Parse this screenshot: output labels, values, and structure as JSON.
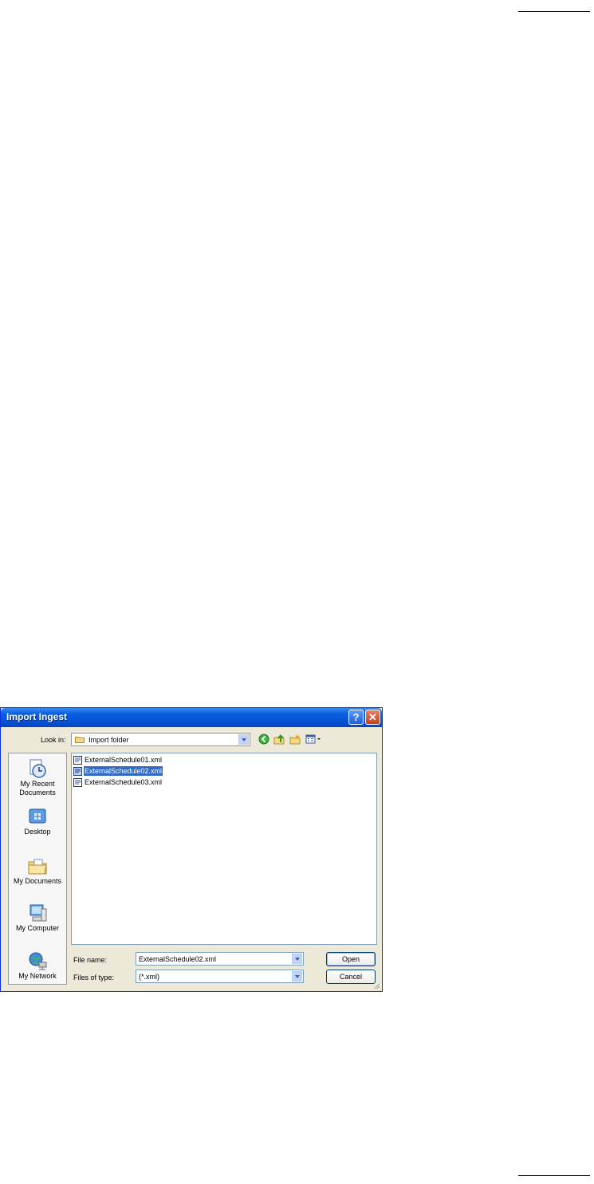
{
  "dialog": {
    "title": "Import Ingest",
    "help_glyph": "?",
    "close_glyph": "✕"
  },
  "lookin": {
    "label": "Look in:",
    "value": "Import folder"
  },
  "toolbar": {
    "icons": [
      "back-icon",
      "up-folder-icon",
      "new-folder-icon",
      "views-menu-icon"
    ]
  },
  "places": [
    {
      "label": "My Recent Documents",
      "icon": "recent-documents-icon"
    },
    {
      "label": "Desktop",
      "icon": "desktop-icon"
    },
    {
      "label": "My Documents",
      "icon": "my-documents-icon"
    },
    {
      "label": "My Computer",
      "icon": "my-computer-icon"
    },
    {
      "label": "My Network",
      "icon": "my-network-icon"
    }
  ],
  "files": [
    {
      "name": "ExternalSchedule01.xml",
      "selected": false
    },
    {
      "name": "ExternalSchedule02.xml",
      "selected": true
    },
    {
      "name": "ExternalSchedule03.xml",
      "selected": false
    }
  ],
  "filename": {
    "label": "File name:",
    "value": "ExternalSchedule02.xml"
  },
  "filetype": {
    "label": "Files of type:",
    "value": "(*.xml)"
  },
  "buttons": {
    "open": "Open",
    "cancel": "Cancel"
  },
  "colors": {
    "title_bar": "#0A5FE0",
    "selection": "#316AC5",
    "dialog_face": "#ECE9D8"
  }
}
